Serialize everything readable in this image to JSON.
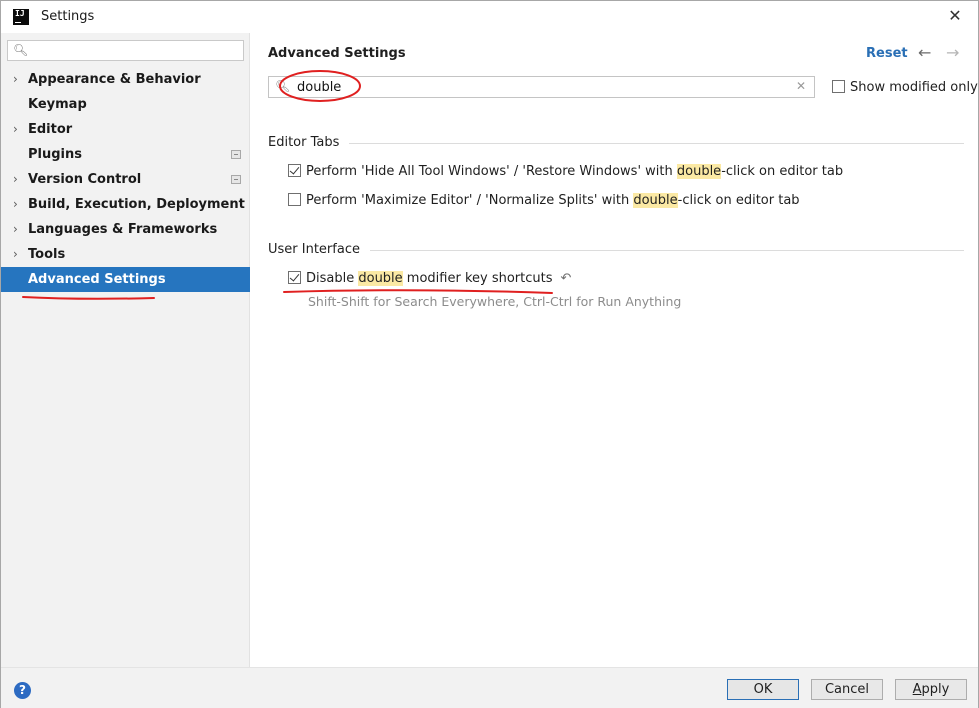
{
  "window": {
    "title": "Settings",
    "app_icon_text": "IJ"
  },
  "sidebar": {
    "search": {
      "value": "",
      "placeholder": ""
    },
    "items": [
      {
        "label": "Appearance & Behavior",
        "expandable": true,
        "project_icon": false
      },
      {
        "label": "Keymap",
        "expandable": false,
        "project_icon": false
      },
      {
        "label": "Editor",
        "expandable": true,
        "project_icon": false
      },
      {
        "label": "Plugins",
        "expandable": false,
        "project_icon": true
      },
      {
        "label": "Version Control",
        "expandable": true,
        "project_icon": true
      },
      {
        "label": "Build, Execution, Deployment",
        "expandable": true,
        "project_icon": false
      },
      {
        "label": "Languages & Frameworks",
        "expandable": true,
        "project_icon": false
      },
      {
        "label": "Tools",
        "expandable": true,
        "project_icon": false
      },
      {
        "label": "Advanced Settings",
        "expandable": false,
        "project_icon": false,
        "selected": true
      }
    ]
  },
  "main": {
    "title": "Advanced Settings",
    "reset_label": "Reset",
    "search": {
      "value": "double"
    },
    "show_modified_label": "Show modified only",
    "sections": {
      "editor_tabs": {
        "title": "Editor Tabs",
        "opt1": {
          "before": "Perform 'Hide All Tool Windows' / 'Restore Windows' with ",
          "match": "double",
          "after": "-click on editor tab",
          "checked": true
        },
        "opt2": {
          "before": "Perform 'Maximize Editor' / 'Normalize Splits' with ",
          "match": "double",
          "after": "-click on editor tab",
          "checked": false
        }
      },
      "user_interface": {
        "title": "User Interface",
        "opt1": {
          "before": "Disable ",
          "match": "double",
          "after": " modifier key shortcuts",
          "checked": true,
          "hint": "Shift-Shift for Search Everywhere, Ctrl-Ctrl for Run Anything"
        }
      }
    }
  },
  "footer": {
    "help": "?",
    "ok": "OK",
    "cancel": "Cancel",
    "apply_first": "A",
    "apply_rest": "pply"
  },
  "colors": {
    "accent": "#2675bf",
    "highlight": "#fbe9a4",
    "annotation": "#e02020"
  }
}
